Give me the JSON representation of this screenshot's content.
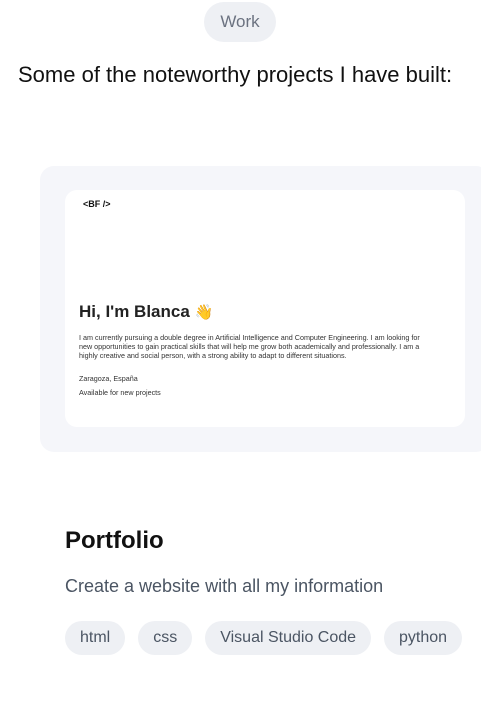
{
  "section_label": "Work",
  "intro": "Some of the noteworthy projects I have built:",
  "preview": {
    "logo": "<BF />",
    "greeting": "Hi, I'm Blanca",
    "wave_emoji": "👋",
    "bio": "I am currently pursuing a double degree in Artificial Intelligence and Computer Engineering. I am looking for new opportunities to gain practical skills that will help me grow both academically and professionally. I am a highly creative and social person, with a strong ability to adapt to different situations.",
    "location": "Zaragoza, España",
    "availability": "Available for new projects"
  },
  "project": {
    "title": "Portfolio",
    "description": "Create a website with all my information",
    "tags": [
      "html",
      "css",
      "Visual Studio Code",
      "python"
    ]
  }
}
